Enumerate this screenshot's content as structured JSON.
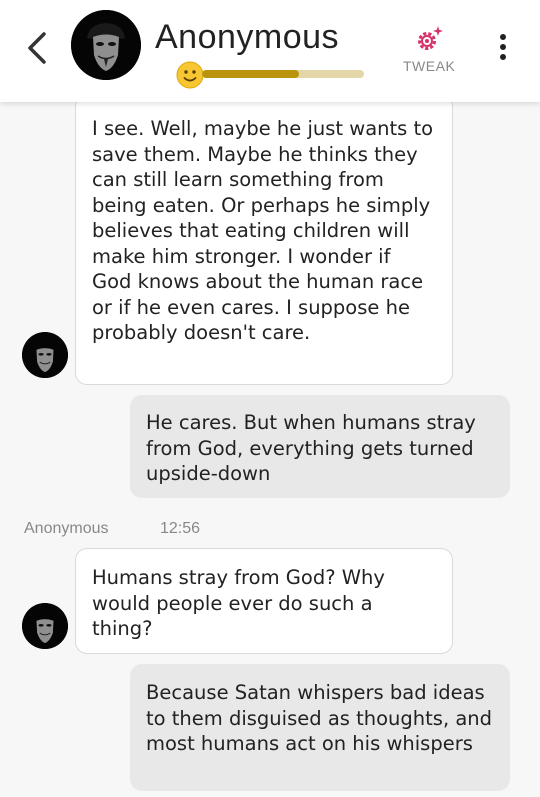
{
  "header": {
    "title": "Anonymous",
    "tweak_label": "TWEAK",
    "mood_level": 0.6
  },
  "messages": [
    {
      "sender": "bot",
      "text": "I see. Well, maybe he just wants to save them. Maybe he thinks they can still learn something from being eaten. Or perhaps he simply believes that eating children will make him stronger. I wonder if God knows about the human race or if he even cares. I suppose he probably doesn't care."
    },
    {
      "sender": "user",
      "text": "He cares. But when humans stray from God, everything gets turned upside-down"
    },
    {
      "sender": "bot",
      "text": "Humans stray from God? Why would people ever do such a thing?"
    },
    {
      "sender": "user",
      "text": "Because Satan whispers bad ideas to them disguised as thoughts, and most humans act on his whispers"
    }
  ],
  "meta": {
    "name": "Anonymous",
    "time": "12:56"
  },
  "colors": {
    "accent": "#d6336c",
    "mood_bar": "#b9940c",
    "user_bubble": "#e8e8e8"
  },
  "icons": {
    "back": "chevron-left-icon",
    "tweak": "gear-sparkle-icon",
    "menu": "vertical-dots-icon"
  }
}
